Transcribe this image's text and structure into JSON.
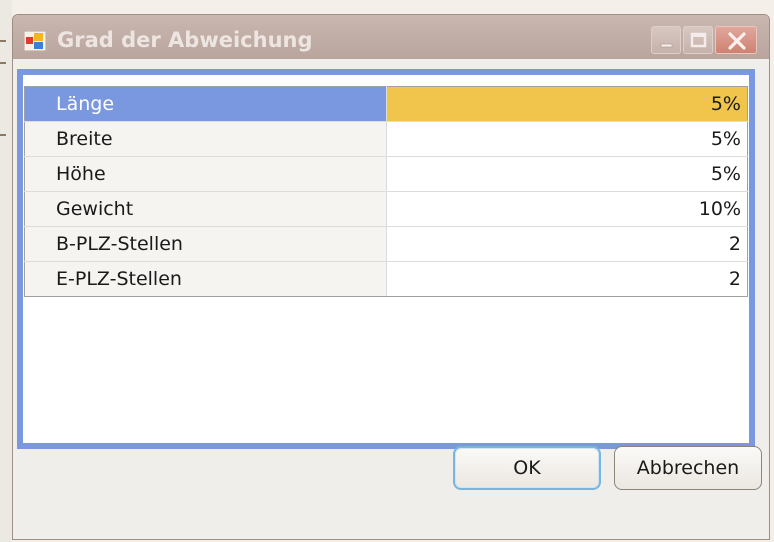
{
  "window": {
    "title": "Grad der Abweichung",
    "buttons": {
      "minimize": "minimize-icon",
      "maximize": "maximize-icon",
      "close": "close-icon"
    }
  },
  "grid": {
    "rows": [
      {
        "name": "Länge",
        "value": "5%",
        "selected": true
      },
      {
        "name": "Breite",
        "value": "5%",
        "selected": false
      },
      {
        "name": "Höhe",
        "value": "5%",
        "selected": false
      },
      {
        "name": "Gewicht",
        "value": "10%",
        "selected": false
      },
      {
        "name": "B-PLZ-Stellen",
        "value": "2",
        "selected": false
      },
      {
        "name": "E-PLZ-Stellen",
        "value": "2",
        "selected": false
      }
    ]
  },
  "actions": {
    "ok_label": "OK",
    "cancel_label": "Abbrechen"
  },
  "colors": {
    "selection_name": "#7a98e0",
    "selection_value": "#f1c44c",
    "frame": "#7a98e0",
    "titlebar": "#c0aca5"
  }
}
